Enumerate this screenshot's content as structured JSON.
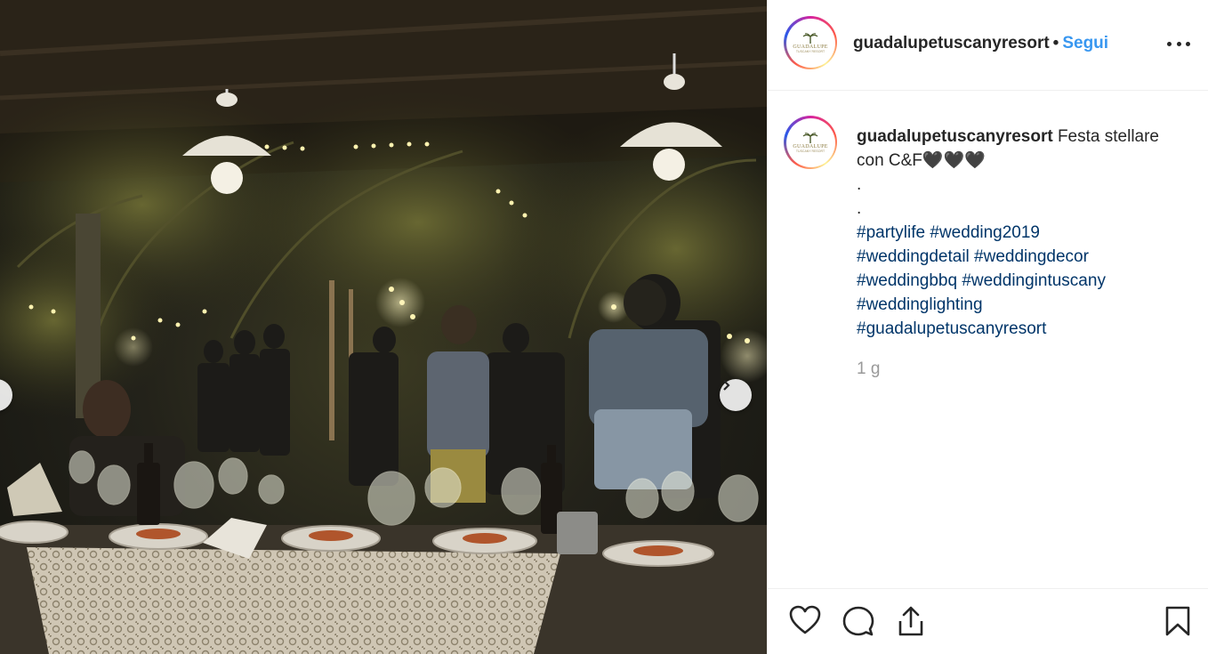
{
  "post": {
    "username": "guadalupetuscanyresort",
    "follow_label": "Segui",
    "separator": "•",
    "avatar_logo_text": "GUADALUPE",
    "avatar_logo_sub": "TUSCANY RESORT",
    "caption_text": "Festa stellare con C&F🖤🖤🖤",
    "caption_dots": [
      ".",
      "."
    ],
    "hashtag_lines": [
      [
        "#partylife",
        "#wedding2019"
      ],
      [
        "#weddingdetail",
        "#weddingdecor"
      ],
      [
        "#weddingbbq",
        "#weddingintuscany"
      ],
      [
        "#weddinglighting"
      ],
      [
        "#guadalupetuscanyresort"
      ]
    ],
    "timestamp": "1 g"
  },
  "icons": {
    "more": "more-options-icon",
    "like": "heart-icon",
    "comment": "comment-icon",
    "share": "share-icon",
    "save": "bookmark-icon",
    "next": "chevron-right-icon",
    "prev": "chevron-left-icon"
  },
  "colors": {
    "link_blue": "#3897f0",
    "hashtag": "#003569",
    "muted": "#999999",
    "text": "#262626"
  }
}
